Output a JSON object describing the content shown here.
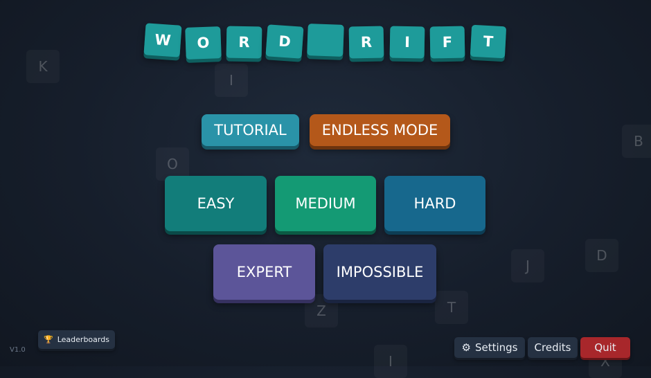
{
  "title": {
    "letters": [
      "W",
      "O",
      "R",
      "D",
      "",
      "R",
      "I",
      "F",
      "T"
    ]
  },
  "mode_buttons": {
    "tutorial": "TUTORIAL",
    "endless": "ENDLESS MODE"
  },
  "difficulty_buttons": {
    "easy": "EASY",
    "medium": "MEDIUM",
    "hard": "HARD",
    "expert": "EXPERT",
    "impossible": "IMPOSSIBLE"
  },
  "footer": {
    "leaderboards": "Leaderboards",
    "settings": "Settings",
    "credits": "Credits",
    "quit": "Quit",
    "version": "V1.0"
  },
  "background_letters": [
    "K",
    "I",
    "O",
    "B",
    "J",
    "D",
    "Z",
    "T",
    "I",
    "X"
  ],
  "colors": {
    "title_tile": "#1e9b9a",
    "tutorial": "#2a93a8",
    "endless": "#b4581a",
    "easy": "#127d7a",
    "medium": "#149a74",
    "hard": "#17688d",
    "expert": "#5c5599",
    "impossible": "#2d3d6a",
    "quit": "#a8272b"
  },
  "icons": {
    "leaderboards": "trophy-icon",
    "settings": "gear-icon"
  }
}
